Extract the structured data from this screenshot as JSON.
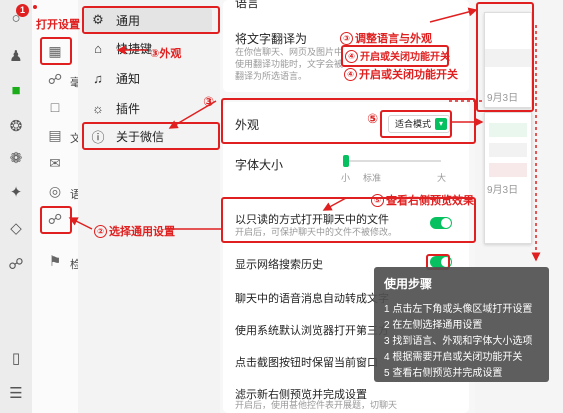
{
  "settings_nav": {
    "items": [
      {
        "label": "通用",
        "icon": "gear-icon"
      },
      {
        "label": "快捷键",
        "icon": "shortcut-icon"
      },
      {
        "label": "通知",
        "icon": "bell-icon"
      },
      {
        "label": "插件",
        "icon": "plugin-icon"
      },
      {
        "label": "关于微信",
        "icon": "info-icon"
      }
    ]
  },
  "strip": {
    "fragments": [
      "毫",
      "文",
      "语",
      "检"
    ]
  },
  "content": {
    "top_partial_label": "语言",
    "translate": {
      "title": "将文字翻译为",
      "desc": "在你信聊天、网页及图片中使用翻译功能时，文字会被翻译为所选语言。"
    },
    "appearance": {
      "title": "外观",
      "value": "适合模式"
    },
    "font_size": {
      "title": "字体大小",
      "small": "小",
      "standard": "标准",
      "large": "大"
    },
    "readonly": {
      "title": "以只读的方式打开聊天中的文件",
      "desc": "开启后，可保护聊天中的文件不被修改。"
    },
    "rows": [
      "显示网络搜索历史",
      "聊天中的语音消息自动转成文字",
      "使用系统默认浏览器打开第三方",
      "点击截图按钮时保留当前窗口",
      "滤示新右侧预览并完成设置"
    ],
    "bottom_desc": "开启后，使用甚他控件表开展题，切聊天"
  },
  "right_shots": {
    "date1": "9月3日",
    "date2": "9月3日"
  },
  "annotations": {
    "open_settings": "打开设置",
    "step1_badge": "1",
    "appearance": "③外观",
    "adjust_lang": "调整语言与外观",
    "toggle_function": "开启或关闭功能开关",
    "toggle_function2": "开启或关闭功能开关",
    "choose_general": "选择通用设置",
    "preview": "查看右侧预览效果",
    "n2": "②",
    "n3": "③",
    "n4": "④",
    "n5": "⑤",
    "n5b": "⑤",
    "n3b": "③"
  },
  "steps": {
    "title": "使用步骤",
    "items": [
      "1 点击左下角或头像区域打开设置",
      "2 在左侧选择通用设置",
      "3 找到语言、外观和字体大小选项",
      "4 根据需要开启或关闭功能开关",
      "5 查看右侧预览并完成设置"
    ]
  },
  "colors": {
    "accent": "#07c160",
    "annotation": "#e02020"
  }
}
